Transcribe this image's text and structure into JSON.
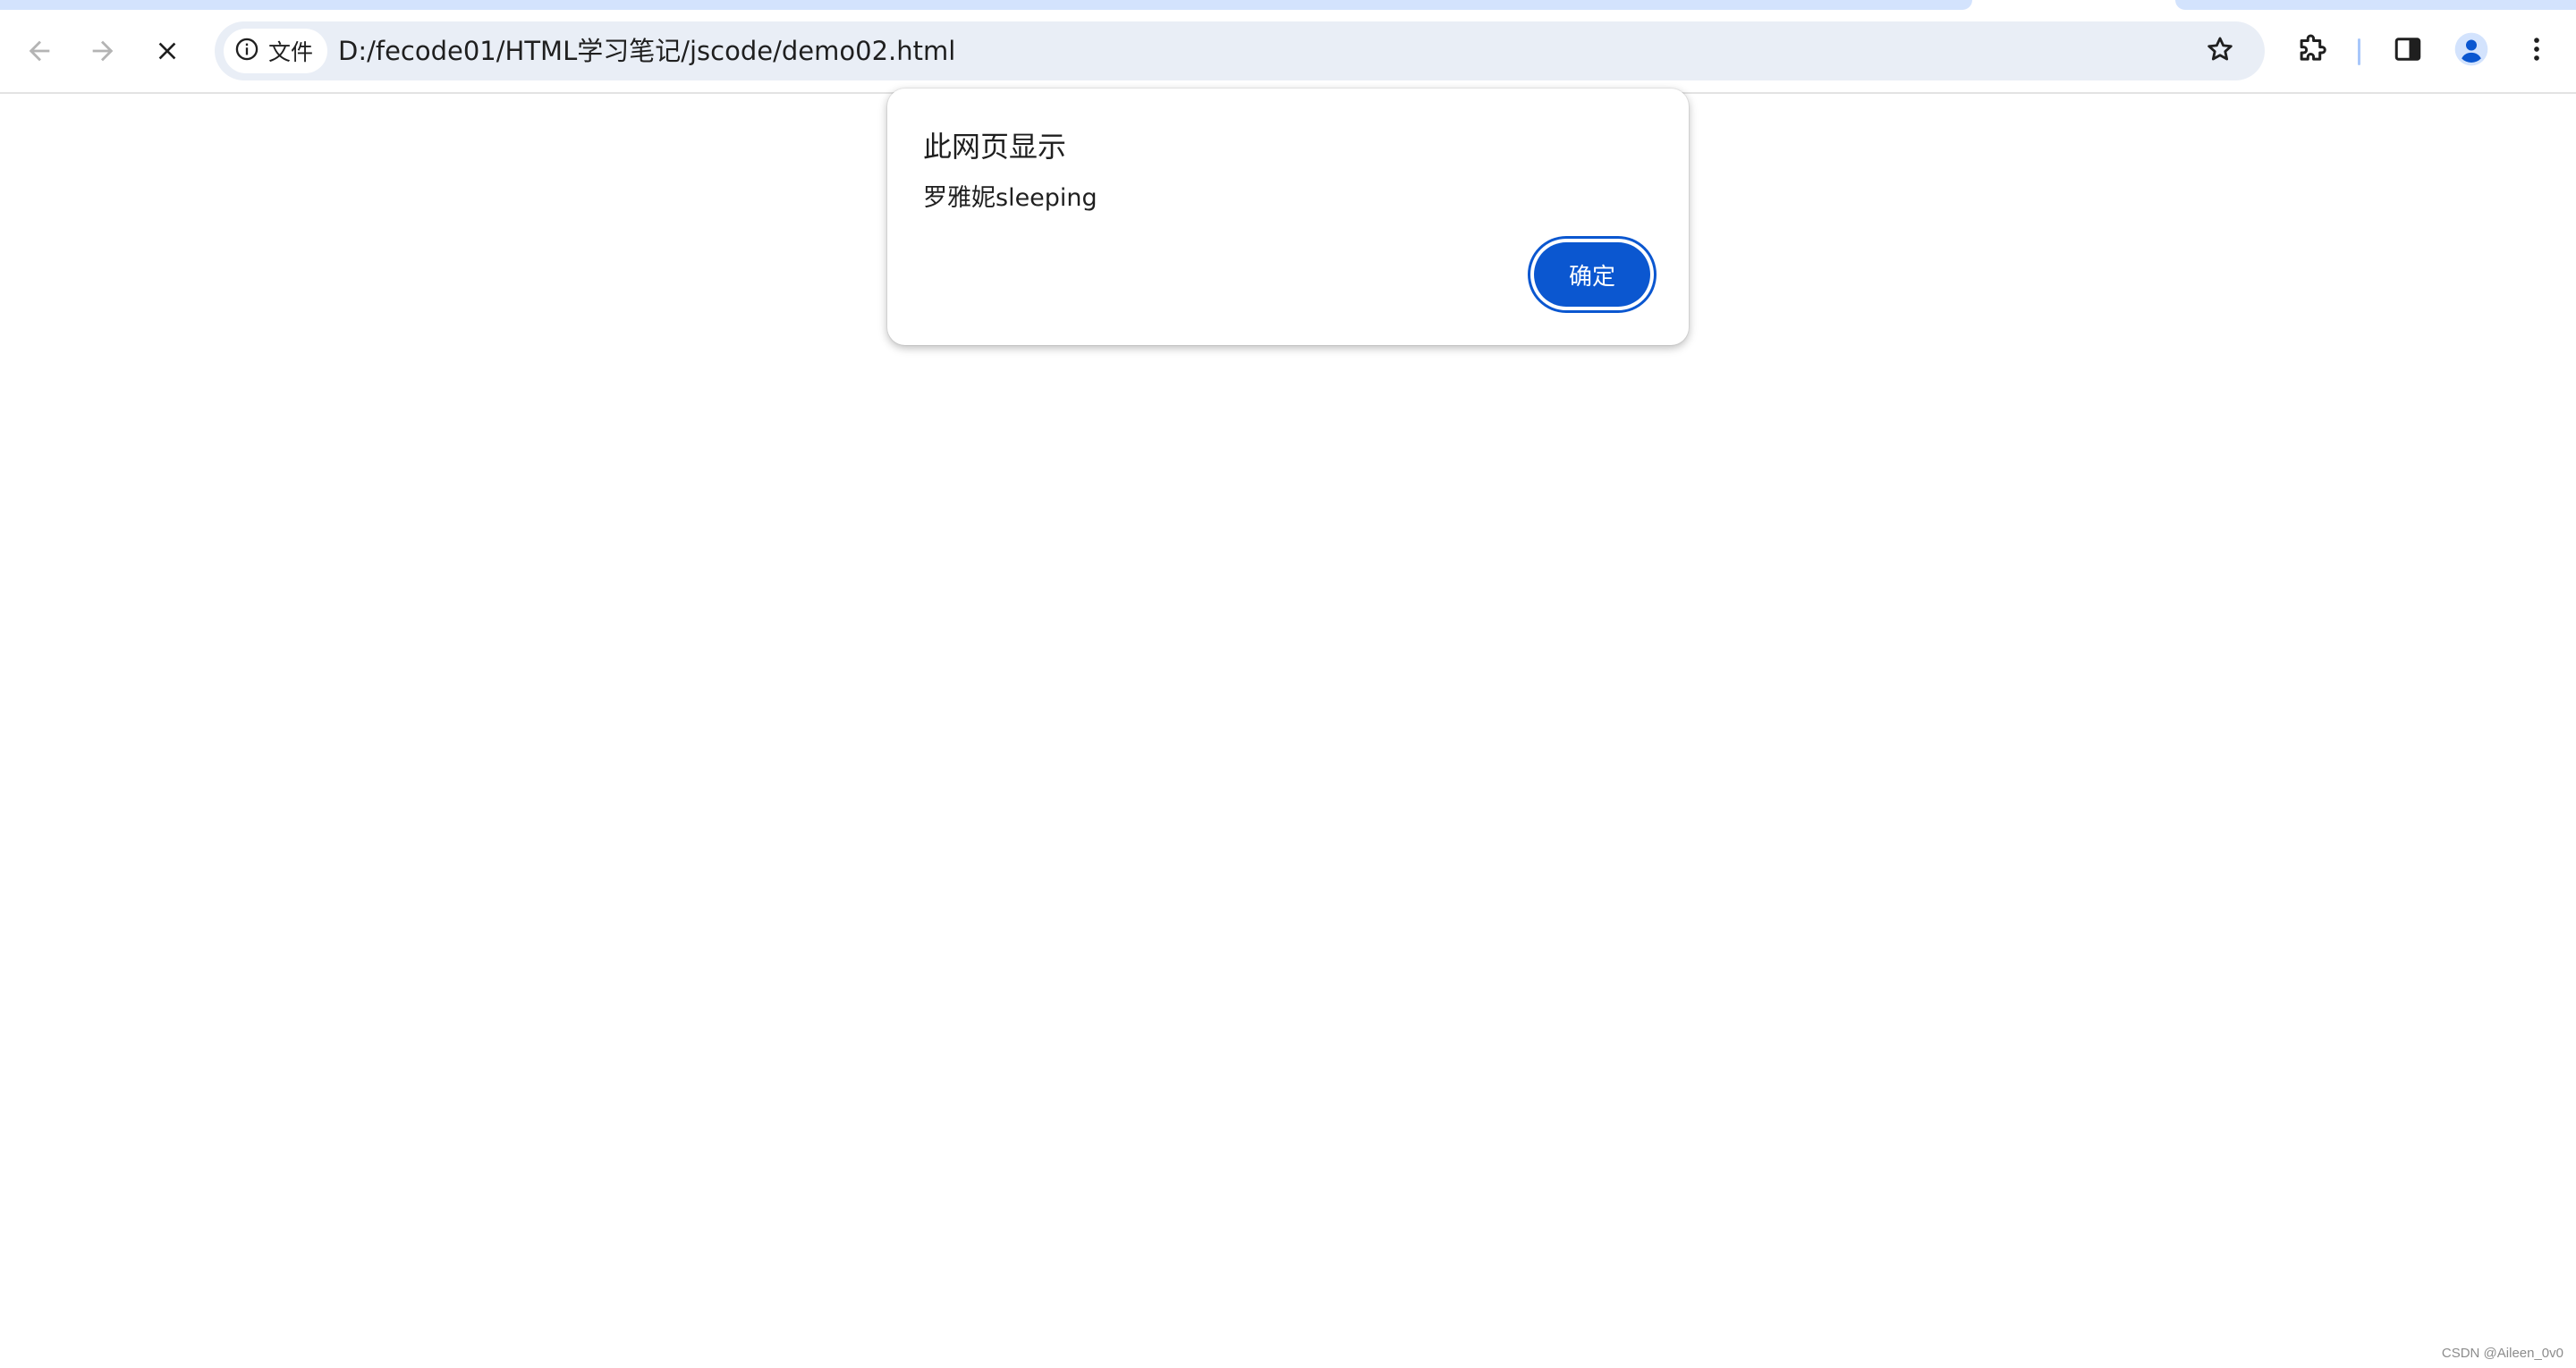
{
  "browser": {
    "tabstrip": {
      "accent_color": "#d3e3fd"
    },
    "nav": {
      "back_icon": "arrow-left-icon",
      "forward_icon": "arrow-right-icon",
      "stop_icon": "close-icon"
    },
    "omnibox": {
      "chip_icon": "info-icon",
      "chip_label": "文件",
      "url": "D:/fecode01/HTML学习笔记/jscode/demo02.html",
      "bookmark_icon": "star-icon"
    },
    "toolbar": {
      "extensions_icon": "puzzle-piece-icon",
      "side_panel_icon": "side-panel-icon",
      "profile_icon": "avatar-icon",
      "menu_icon": "kebab-menu-icon"
    }
  },
  "dialog": {
    "title": "此网页显示",
    "message": "罗雅妮sleeping",
    "ok_label": "确定",
    "accent_color": "#0b57d0"
  },
  "watermark": "CSDN @Aileen_0v0"
}
